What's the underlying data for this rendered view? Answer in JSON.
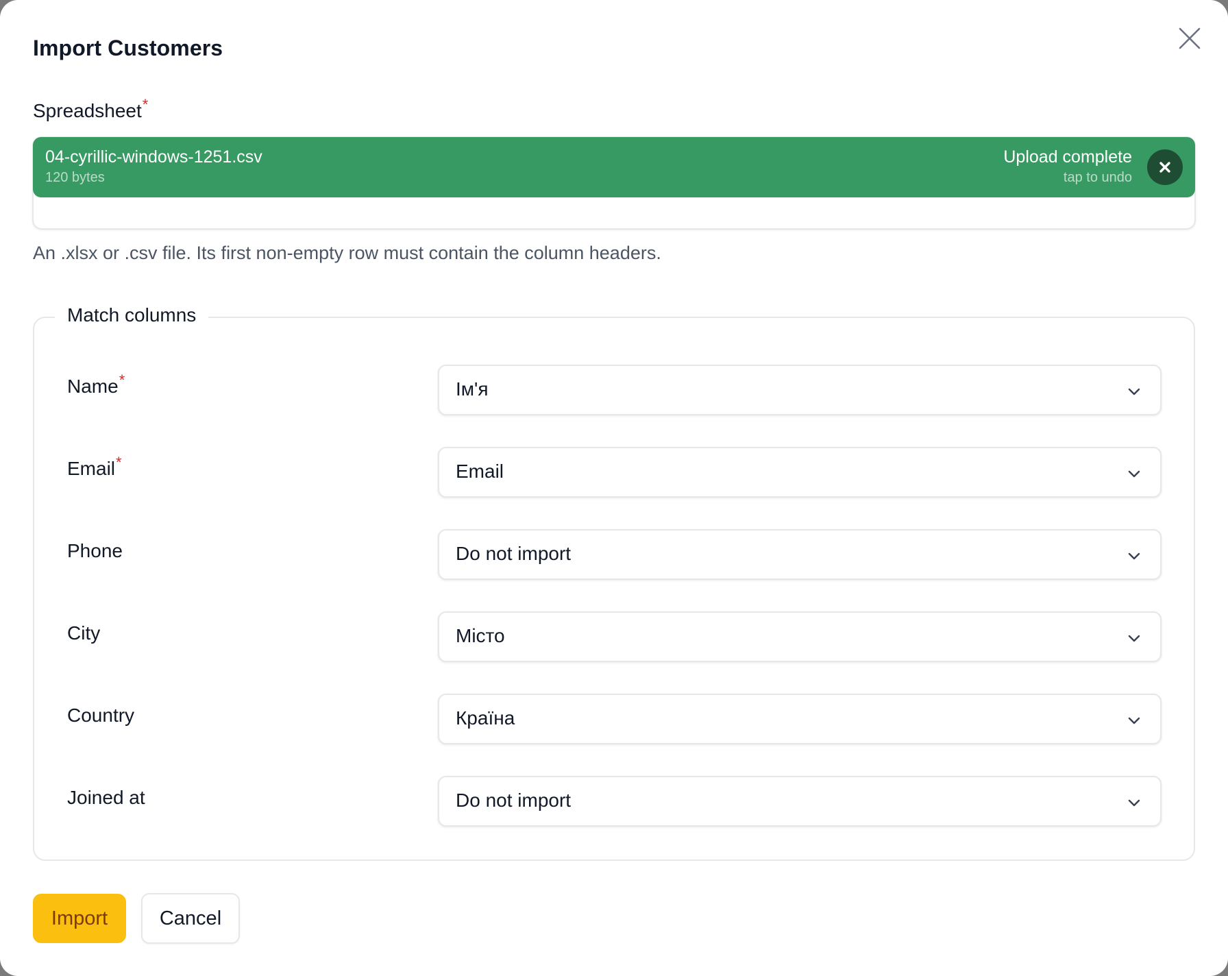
{
  "dialog": {
    "title": "Import Customers"
  },
  "spreadsheet": {
    "label": "Spreadsheet",
    "required_mark": "*",
    "file_name": "04-cyrillic-windows-1251.csv",
    "file_size": "120 bytes",
    "status": "Upload complete",
    "status_hint": "tap to undo",
    "help": "An .xlsx or .csv file. Its first non-empty row must contain the column headers."
  },
  "match_columns": {
    "legend": "Match columns",
    "rows": [
      {
        "label": "Name",
        "required": "*",
        "value": "Ім'я"
      },
      {
        "label": "Email",
        "required": "*",
        "value": "Email"
      },
      {
        "label": "Phone",
        "required": "",
        "value": "Do not import"
      },
      {
        "label": "City",
        "required": "",
        "value": "Місто"
      },
      {
        "label": "Country",
        "required": "",
        "value": "Країна"
      },
      {
        "label": "Joined at",
        "required": "",
        "value": "Do not import"
      }
    ]
  },
  "actions": {
    "import_label": "Import",
    "cancel_label": "Cancel"
  },
  "colors": {
    "upload_bar": "#369a62",
    "undo_button": "#1f4d34",
    "primary_button": "#fbbf10",
    "required": "#dc2626"
  },
  "icons": {
    "close": "close-icon",
    "undo": "x-icon",
    "select": "chevron-down-icon"
  }
}
